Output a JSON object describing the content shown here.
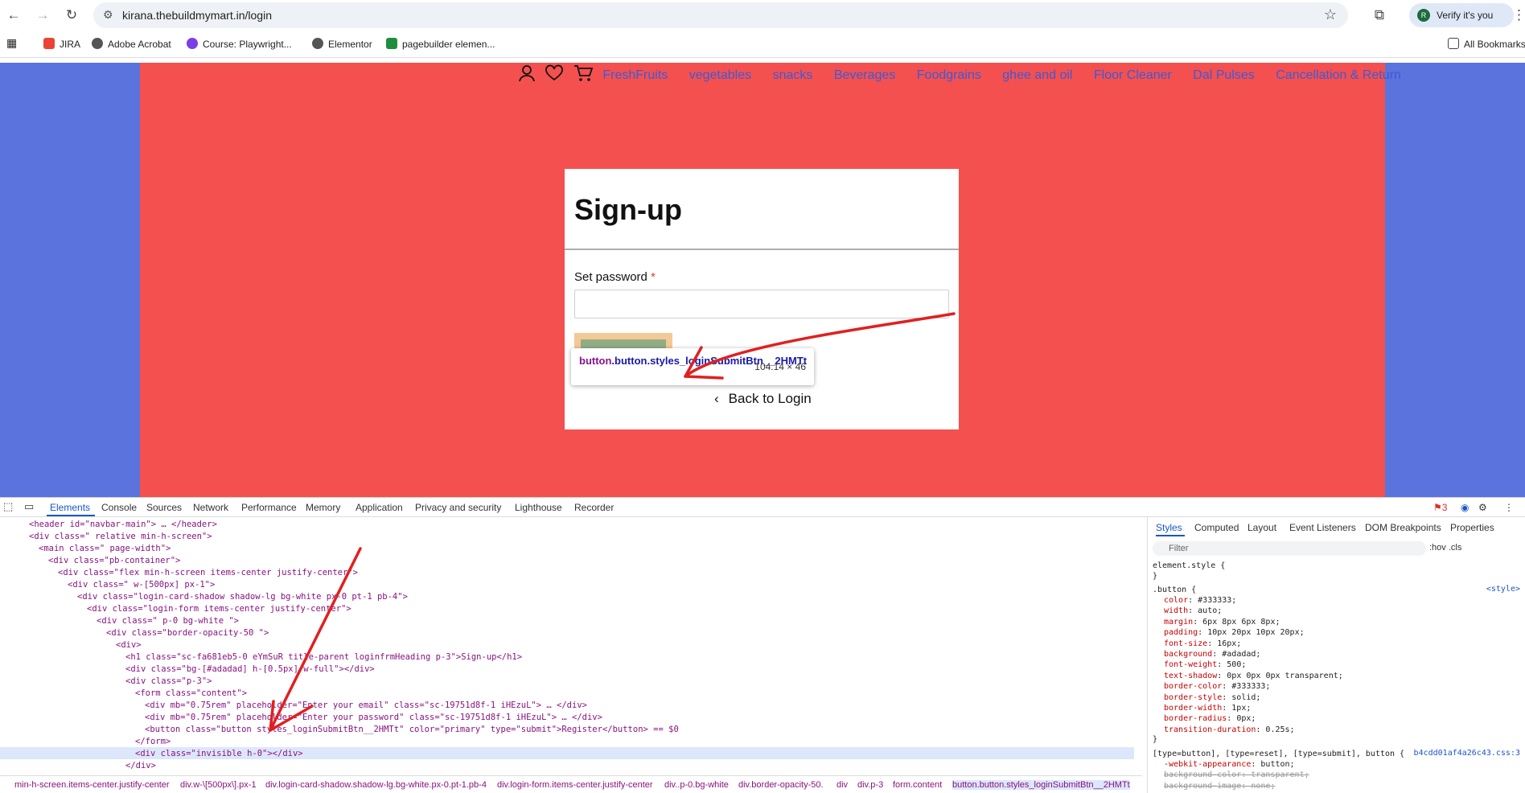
{
  "browser": {
    "url": "kirana.thebuildmymart.in/login",
    "verify_label": "Verify it's you",
    "avatar_letter": "R",
    "bookmarks": [
      "JIRA",
      "Adobe Acrobat",
      "Course: Playwright...",
      "Elementor",
      "pagebuilder elemen..."
    ],
    "all_bookmarks": "All Bookmarks"
  },
  "site": {
    "nav_links": [
      "FreshFruits",
      "vegetables",
      "snacks",
      "Beverages",
      "Foodgrains",
      "ghee and oil",
      "Floor Cleaner",
      "Dal Pulses",
      "Cancellation & Return"
    ],
    "card": {
      "title": "Sign-up",
      "password_label": "Set password",
      "required_mark": "*",
      "register_label": "Register",
      "back_label": "Back to Login"
    },
    "tooltip": {
      "tag": "button",
      "classes": ".button.styles_loginSubmitBtn__2HMTt",
      "dimensions": "104.14 × 46"
    }
  },
  "devtools": {
    "tabs": [
      "Elements",
      "Console",
      "Sources",
      "Network",
      "Performance",
      "Memory",
      "Application",
      "Privacy and security",
      "Lighthouse",
      "Recorder"
    ],
    "issues_count": "3",
    "dom_lines": [
      "<header id=\"navbar-main\"> … </header>",
      "<div class=\" relative min-h-screen\">",
      "<main class=\" page-width\">",
      "<div class=\"pb-container\">",
      "<div class=\"flex min-h-screen items-center justify-center\">",
      "<div class=\" w-[500px]  px-1\">",
      "<div class=\"login-card-shadow shadow-lg bg-white px-0 pt-1 pb-4\">",
      "<div class=\"login-form  items-center justify-center\">",
      "<div class=\" p-0 bg-white  \">",
      "<div class=\"border-opacity-50 \">",
      "<div>",
      "<h1 class=\"sc-fa681eb5-0 eYmSuR title-parent loginfrmHeading p-3\">Sign-up</h1>",
      "<div class=\"bg-[#adadad] h-[0.5px] w-full\"></div>",
      "<div class=\"p-3\">",
      "<form class=\"content\">",
      "<div mb=\"0.75rem\" placeholder=\"Enter your email\" class=\"sc-19751d8f-1 iHEzuL\"> … </div>",
      "<div mb=\"0.75rem\" placeholder=\"Enter your password\" class=\"sc-19751d8f-1 iHEzuL\"> … </div>",
      "<button class=\"button styles_loginSubmitBtn__2HMTt\" color=\"primary\" type=\"submit\">Register</button>  == $0",
      "</form>",
      "<div class=\"invisible h-0\"></div>",
      "</div>"
    ],
    "breadcrumbs": [
      "min-h-screen.items-center.justify-center",
      "div.w-\\[500px\\].px-1",
      "div.login-card-shadow.shadow-lg.bg-white.px-0.pt-1.pb-4",
      "div.login-form.items-center.justify-center",
      "div..p-0.bg-white",
      "div.border-opacity-50.",
      "div",
      "div.p-3",
      "form.content",
      "button.button.styles_loginSubmitBtn__2HMTt"
    ],
    "styles_tabs": [
      "Styles",
      "Computed",
      "Layout",
      "Event Listeners",
      "DOM Breakpoints",
      "Properties"
    ],
    "filter_placeholder": "Filter",
    "filter_tools": ":hov  .cls",
    "css": {
      "element_style": "element.style {",
      "element_close": "}",
      "rule_selector": ".button {",
      "rule_source": "<style>",
      "props": [
        [
          "color",
          "#333333;"
        ],
        [
          "width",
          "auto;"
        ],
        [
          "margin",
          "6px 8px 6px 8px;"
        ],
        [
          "padding",
          "10px 20px 10px 20px;"
        ],
        [
          "font-size",
          "16px;"
        ],
        [
          "background",
          "#adadad;"
        ],
        [
          "font-weight",
          "500;"
        ],
        [
          "text-shadow",
          "0px 0px 0px transparent;"
        ],
        [
          "border-color",
          "#333333;"
        ],
        [
          "border-style",
          "solid;"
        ],
        [
          "border-width",
          "1px;"
        ],
        [
          "border-radius",
          "0px;"
        ],
        [
          "transition-duration",
          "0.25s;"
        ]
      ],
      "rule_close": "}",
      "second_selector": "[type=button], [type=reset], [type=submit], button {",
      "second_source": "b4cdd01af4a26c43.css:3",
      "second_props": [
        [
          "-webkit-appearance",
          "button;"
        ],
        [
          "background-color",
          "transparent;"
        ],
        [
          "background-image",
          "none;"
        ]
      ]
    }
  },
  "colors": {
    "page_bg": "#f45050",
    "side_bg": "#5b73dc",
    "nav_link": "#3d5ad6",
    "arrow": "#e02020"
  }
}
